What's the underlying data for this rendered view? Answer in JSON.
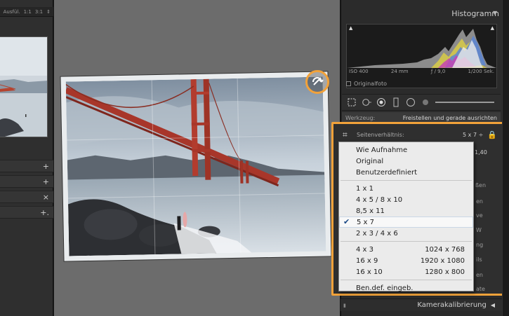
{
  "left_panel": {
    "zoom_options": [
      "Ausfül.",
      "1:1",
      "3:1"
    ],
    "panels": [
      {
        "sign": "+"
      },
      {
        "sign": "+"
      },
      {
        "sign": "×"
      },
      {
        "sign": "+."
      }
    ]
  },
  "histogram": {
    "title": "Histogramm",
    "meta": [
      "ISO 400",
      "24 mm",
      "ƒ / 9,0",
      "1/200 Sek."
    ],
    "original_photo_label": "Originalfoto"
  },
  "tool_row": {
    "label": "Werkzeug:",
    "value": "Freistellen und gerade ausrichten"
  },
  "crop": {
    "aspect_label": "Seitenverhältnis:",
    "aspect_value": "5 x 7 ÷",
    "side_value": "1,40",
    "peek_labels": [
      "ßen",
      "en",
      "ve",
      "W",
      "ng",
      "ils",
      "en",
      "ate"
    ]
  },
  "menu": {
    "group1": [
      "Wie Aufnahme",
      "Original",
      "Benutzerdefiniert"
    ],
    "group2": [
      "1 x 1",
      "4 x 5 / 8 x 10",
      "8,5 x 11",
      "5 x 7",
      "2 x 3 / 4 x 6"
    ],
    "selected": "5 x 7",
    "group3": [
      {
        "label": "4 x 3",
        "dim": "1024 x 768"
      },
      {
        "label": "16 x 9",
        "dim": "1920 x 1080"
      },
      {
        "label": "16 x 10",
        "dim": "1280 x 800"
      }
    ],
    "custom_entry": "Ben.def. eingeb."
  },
  "bottom_panel": {
    "title": "Kamerakalibrierung"
  },
  "colors": {
    "highlight": "#f2a23a",
    "menu_bg": "#ebebeb",
    "check": "#1c4a86"
  }
}
